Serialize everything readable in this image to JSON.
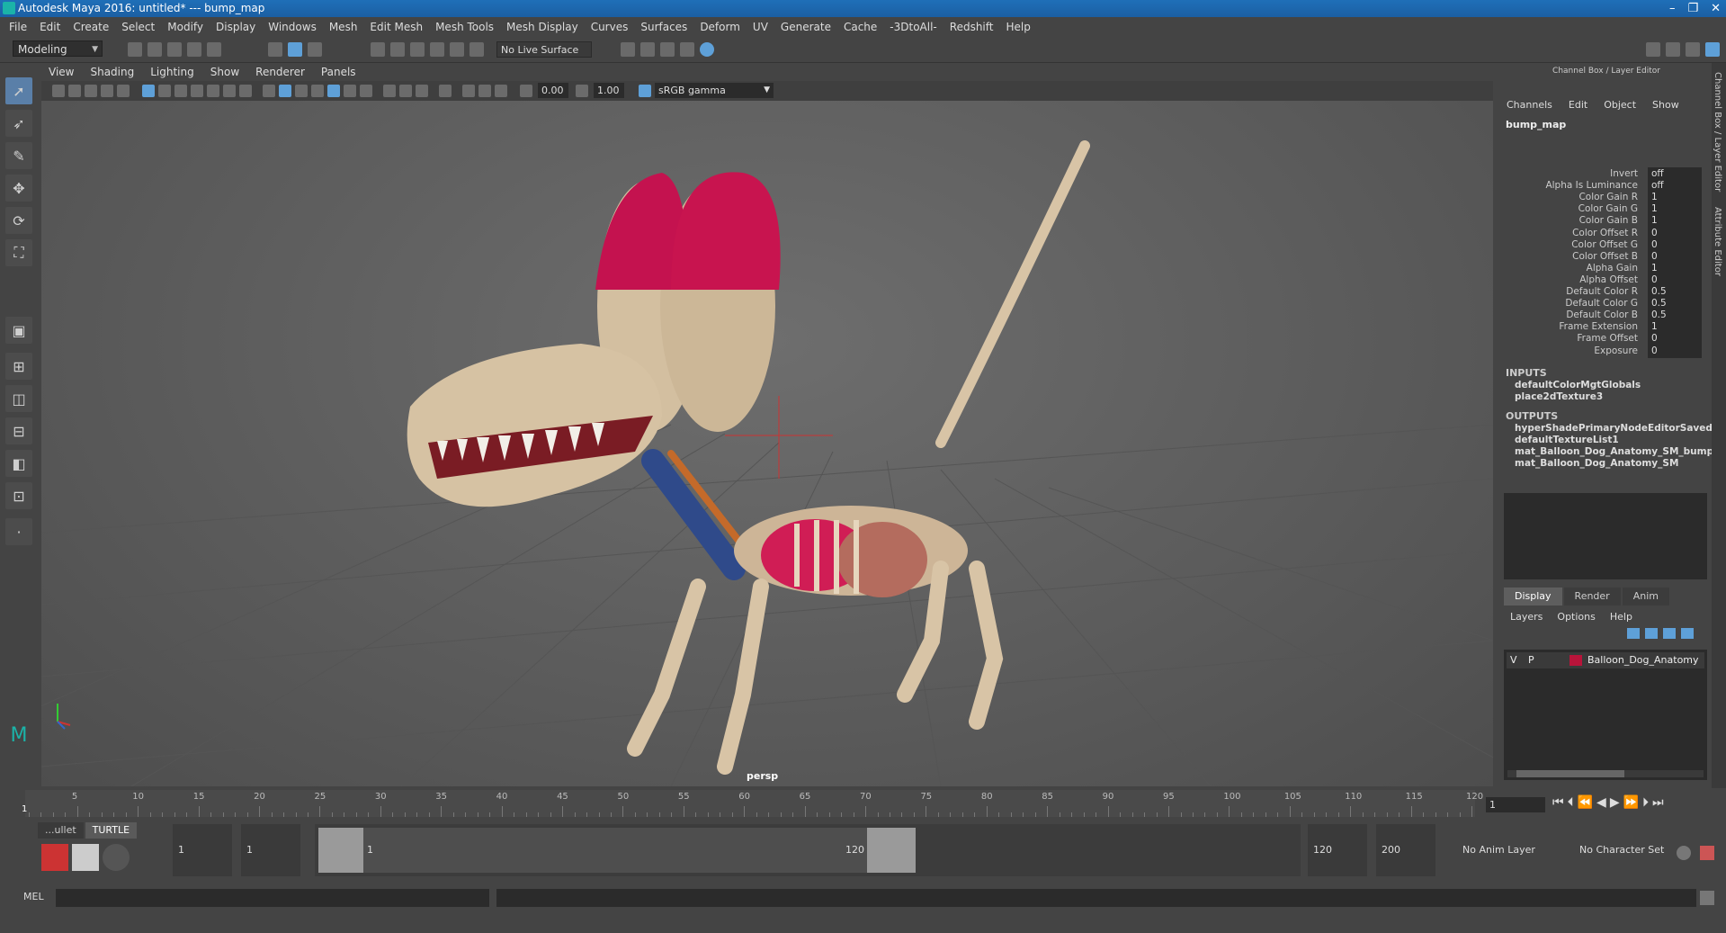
{
  "window": {
    "title": "Autodesk Maya 2016: untitled*   ---   bump_map"
  },
  "menu": [
    "File",
    "Edit",
    "Create",
    "Select",
    "Modify",
    "Display",
    "Windows",
    "Mesh",
    "Edit Mesh",
    "Mesh Tools",
    "Mesh Display",
    "Curves",
    "Surfaces",
    "Deform",
    "UV",
    "Generate",
    "Cache",
    "-3DtoAll-",
    "Redshift",
    "Help"
  ],
  "shelf": {
    "mode": "Modeling",
    "live_surface": "No Live Surface"
  },
  "panel_menu": [
    "View",
    "Shading",
    "Lighting",
    "Show",
    "Renderer",
    "Panels"
  ],
  "panel_toolbar": {
    "exposure": "0.00",
    "gamma": "1.00",
    "color_space": "sRGB gamma"
  },
  "viewport": {
    "camera": "persp"
  },
  "channel_box": {
    "header": "Channel Box / Layer Editor",
    "menu": [
      "Channels",
      "Edit",
      "Object",
      "Show"
    ],
    "node": "bump_map",
    "attributes": [
      {
        "label": "Invert",
        "value": "off"
      },
      {
        "label": "Alpha Is Luminance",
        "value": "off"
      },
      {
        "label": "Color Gain R",
        "value": "1"
      },
      {
        "label": "Color Gain G",
        "value": "1"
      },
      {
        "label": "Color Gain B",
        "value": "1"
      },
      {
        "label": "Color Offset R",
        "value": "0"
      },
      {
        "label": "Color Offset G",
        "value": "0"
      },
      {
        "label": "Color Offset B",
        "value": "0"
      },
      {
        "label": "Alpha Gain",
        "value": "1"
      },
      {
        "label": "Alpha Offset",
        "value": "0"
      },
      {
        "label": "Default Color R",
        "value": "0.5"
      },
      {
        "label": "Default Color G",
        "value": "0.5"
      },
      {
        "label": "Default Color B",
        "value": "0.5"
      },
      {
        "label": "Frame Extension",
        "value": "1"
      },
      {
        "label": "Frame Offset",
        "value": "0"
      },
      {
        "label": "Exposure",
        "value": "0"
      }
    ],
    "inputs_label": "INPUTS",
    "inputs": [
      "defaultColorMgtGlobals",
      "place2dTexture3"
    ],
    "outputs_label": "OUTPUTS",
    "outputs": [
      "hyperShadePrimaryNodeEditorSavedT...",
      "defaultTextureList1",
      "mat_Balloon_Dog_Anatomy_SM_bump",
      "mat_Balloon_Dog_Anatomy_SM"
    ]
  },
  "layer_editor": {
    "tabs": [
      "Display",
      "Render",
      "Anim"
    ],
    "menu": [
      "Layers",
      "Options",
      "Help"
    ],
    "layer": {
      "v": "V",
      "p": "P",
      "name": "Balloon_Dog_Anatomy",
      "color": "#b8143a"
    }
  },
  "side_tabs": [
    "Channel Box / Layer Editor",
    "Attribute Editor"
  ],
  "timeline": {
    "ticks": [
      "5",
      "10",
      "15",
      "20",
      "25",
      "30",
      "35",
      "40",
      "45",
      "50",
      "55",
      "60",
      "65",
      "70",
      "75",
      "80",
      "85",
      "90",
      "95",
      "100",
      "105",
      "110",
      "115",
      "120"
    ],
    "current_marker": "1",
    "current_frame": "1"
  },
  "range": {
    "shelf_tabs": [
      "...ullet",
      "TURTLE"
    ],
    "start": "1",
    "inner_start": "1",
    "slider_start": "1",
    "slider_end": "120",
    "end": "120",
    "anim_end": "200",
    "anim_layer": "No Anim Layer",
    "char_set": "No Character Set"
  },
  "command": {
    "label": "MEL"
  }
}
